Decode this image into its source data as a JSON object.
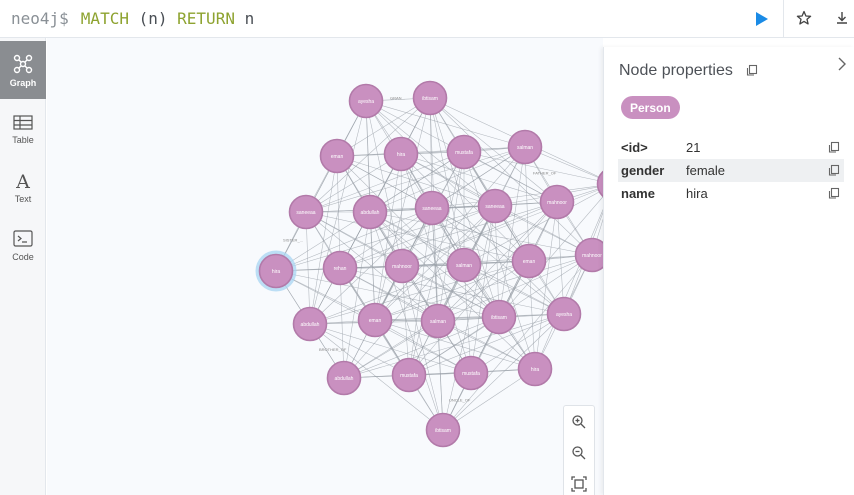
{
  "editor": {
    "prompt": "neo4j$",
    "query_tokens": [
      {
        "text": "MATCH",
        "kind": "kw"
      },
      {
        "text": " ",
        "kind": "space"
      },
      {
        "text": "(n)",
        "kind": "paren"
      },
      {
        "text": " ",
        "kind": "space"
      },
      {
        "text": "RETURN",
        "kind": "kw"
      },
      {
        "text": " n",
        "kind": "paren"
      }
    ],
    "run_icon": "play-icon",
    "favorite_icon": "star-icon",
    "download_icon": "download-icon"
  },
  "sidebar": {
    "tabs": [
      {
        "label": "Graph",
        "icon": "graph-icon",
        "active": true
      },
      {
        "label": "Table",
        "icon": "table-icon",
        "active": false
      },
      {
        "label": "Text",
        "icon": "text-icon",
        "active": false
      },
      {
        "label": "Code",
        "icon": "code-icon",
        "active": false
      }
    ]
  },
  "graph": {
    "node_color": "#c990c0",
    "node_border": "#b27aa9",
    "selected_halo": "#a8d4f2",
    "edge_color": "#9aa0a8",
    "nodes": [
      {
        "label": "ayesha"
      },
      {
        "label": "ibtisam"
      },
      {
        "label": "eman"
      },
      {
        "label": "hira"
      },
      {
        "label": "mustafa"
      },
      {
        "label": "salman"
      },
      {
        "label": "saneeaa"
      },
      {
        "label": "abdullah"
      },
      {
        "label": "saneeaa"
      },
      {
        "label": "saneeaa"
      },
      {
        "label": "mahnoor"
      },
      {
        "label": "hira",
        "selected": true
      },
      {
        "label": "rehan"
      },
      {
        "label": "mahnoor"
      },
      {
        "label": "salman"
      },
      {
        "label": "eman"
      },
      {
        "label": "mahnoor"
      },
      {
        "label": "abdullah"
      },
      {
        "label": "eman"
      },
      {
        "label": "salman"
      },
      {
        "label": "ibtisam"
      },
      {
        "label": "ayesha"
      },
      {
        "label": "abdullah"
      },
      {
        "label": "mustafa"
      },
      {
        "label": "mustafa"
      },
      {
        "label": "hira"
      },
      {
        "label": "ibtisam"
      },
      {
        "label": ""
      }
    ],
    "edge_labels": [
      "GRAN...",
      "FATHER_OF",
      "SISTER_...",
      "BROTHER_OF",
      "UNCLE_OF",
      "BROTH..."
    ]
  },
  "zoom": {
    "zoom_in_icon": "zoom-in-icon",
    "zoom_out_icon": "zoom-out-icon",
    "fit_icon": "fit-to-screen-icon"
  },
  "properties": {
    "title": "Node properties",
    "label": "Person",
    "rows": [
      {
        "key": "<id>",
        "value": "21"
      },
      {
        "key": "gender",
        "value": "female"
      },
      {
        "key": "name",
        "value": "hira"
      }
    ]
  }
}
